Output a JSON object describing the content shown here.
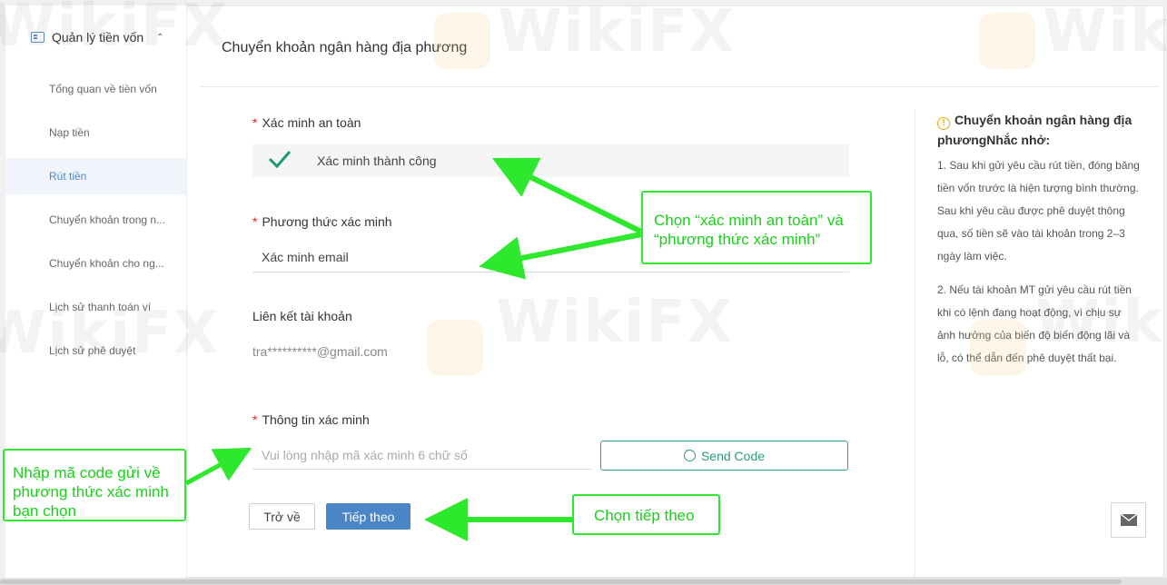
{
  "sidebar": {
    "header": "Quản lý tiền vốn",
    "items": [
      {
        "label": "Tổng quan về tiền vốn"
      },
      {
        "label": "Nạp tiền"
      },
      {
        "label": "Rút tiền"
      },
      {
        "label": "Chuyển khoản trong n..."
      },
      {
        "label": "Chuyển khoản cho ng..."
      },
      {
        "label": "Lịch sử thanh toán ví"
      },
      {
        "label": "Lịch sử phê duyệt"
      }
    ]
  },
  "main": {
    "title": "Chuyển khoản ngân hàng địa phương",
    "security": {
      "label": "Xác minh an toàn",
      "status": "Xác minh thành công"
    },
    "method": {
      "label": "Phương thức xác minh",
      "value": "Xác minh email"
    },
    "account": {
      "label": "Liên kết tài khoản",
      "value": "tra**********@gmail.com"
    },
    "code": {
      "label": "Thông tin xác minh",
      "placeholder": "Vui lòng nhập mã xác minh 6 chữ số",
      "send_label": "Send Code"
    },
    "back_label": "Trở về",
    "next_label": "Tiếp theo",
    "required_mark": "*"
  },
  "note": {
    "title": "Chuyển khoản ngân hàng địa phươngNhắc nhở:",
    "paragraphs": [
      "1. Sau khi gửi yêu cầu rút tiền, đóng băng tiền vốn trước là hiện tượng bình thường. Sau khi yêu cầu được phê duyệt thông qua, số tiền sẽ vào tài khoản trong 2–3 ngày làm việc.",
      "2. Nếu tài khoản MT gửi yêu cầu rút tiền khi có lệnh đang hoạt động, vì chịu sự ảnh hưởng của biến độ biến động lãi và lỗ, có thể dẫn đến phê duyệt thất bại."
    ]
  },
  "annotations": {
    "a1": "Chọn “xác minh an toàn” và “phương thức xác minh”",
    "a2": "Nhập mã code gửi về phương thức xác minh bạn chọn",
    "a3": "Chọn tiếp theo"
  },
  "watermark": "WikiFX",
  "colors": {
    "accent": "#4a86c8",
    "success": "#1e9b6c",
    "annotation": "#2ee82e",
    "warning": "#f0a800"
  }
}
